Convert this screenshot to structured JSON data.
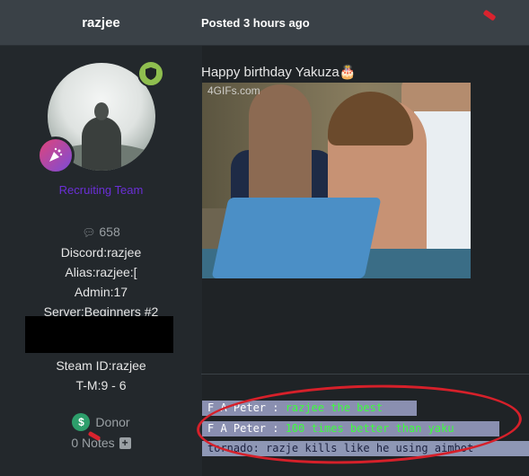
{
  "header": {
    "author": "razjee",
    "posted": "Posted 3 hours ago"
  },
  "profile": {
    "role": "Recruiting Team",
    "message_count": "658",
    "discord": "Discord:razjee",
    "alias": "Alias:razjee:[",
    "admin": "Admin:17",
    "server": "Server:Beginners #2",
    "steam": "Steam ID:razjee",
    "tm": "T-M:9 - 6",
    "donor": "Donor",
    "notes": "0 Notes"
  },
  "post": {
    "text": "Happy birthday Yakuza🎂",
    "gif_watermark": "4GIFs.com"
  },
  "chat": [
    {
      "speaker": "F A Peter : ",
      "message": "razjee the best"
    },
    {
      "speaker": "F A Peter : ",
      "message": "100 times better than yaku"
    },
    {
      "speaker": "tornado: ",
      "message": "razje kills like he using aimbot"
    }
  ],
  "colors": {
    "header_bg": "#3a4147",
    "role_color": "#6a2fd6",
    "chat_message": "#3cff3c",
    "annotation_red": "#d6202a"
  }
}
